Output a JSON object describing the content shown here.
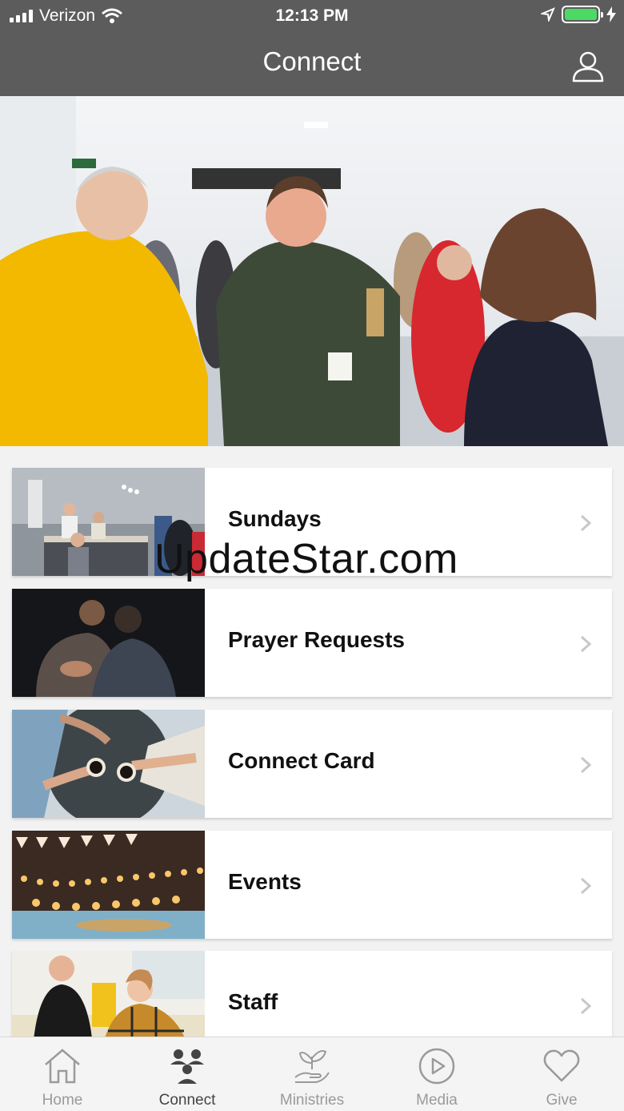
{
  "status_bar": {
    "carrier": "Verizon",
    "time": "12:13 PM"
  },
  "nav": {
    "title": "Connect",
    "profile_icon": "person-outline-icon"
  },
  "hero": {
    "image": "photo of people chatting in church lobby"
  },
  "list": {
    "items": [
      {
        "label": "Sundays",
        "icon": "chevron-right-icon"
      },
      {
        "label": "Prayer Requests",
        "icon": "chevron-right-icon"
      },
      {
        "label": "Connect Card",
        "icon": "chevron-right-icon"
      },
      {
        "label": "Events",
        "icon": "chevron-right-icon"
      },
      {
        "label": "Staff",
        "icon": "chevron-right-icon"
      }
    ]
  },
  "watermark": "UpdateStar.com",
  "tabbar": {
    "tabs": [
      {
        "label": "Home",
        "icon": "home-icon"
      },
      {
        "label": "Connect",
        "icon": "people-icon"
      },
      {
        "label": "Ministries",
        "icon": "hand-plant-icon"
      },
      {
        "label": "Media",
        "icon": "play-circle-icon"
      },
      {
        "label": "Give",
        "icon": "heart-icon"
      }
    ],
    "active": "Connect"
  },
  "colors": {
    "header": "#5c5c5c",
    "battery": "#4cd964",
    "tab_inactive": "#9a9a9a",
    "tab_active": "#444444"
  }
}
